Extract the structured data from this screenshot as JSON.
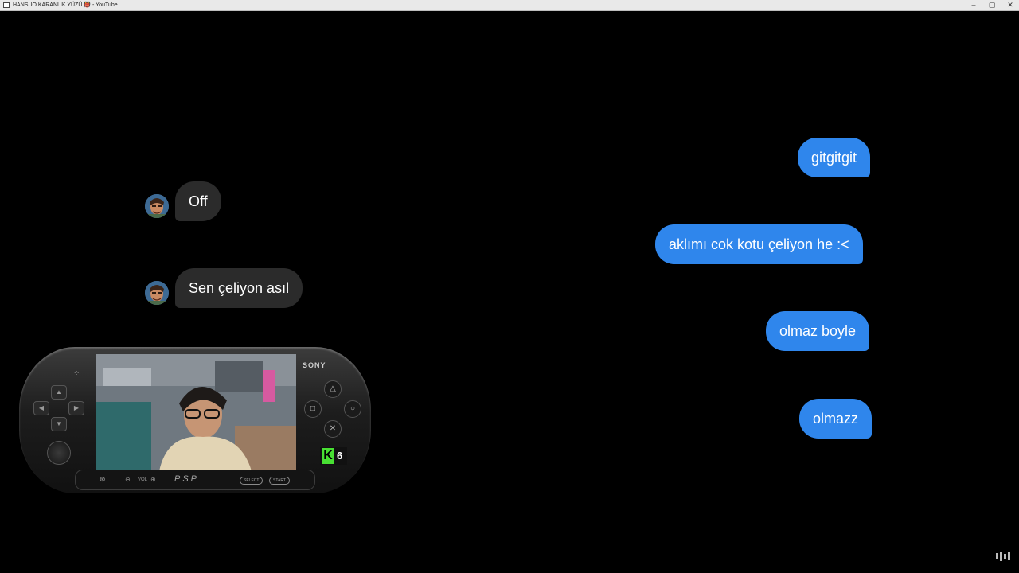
{
  "window": {
    "title": "HANSUO KARANLIK YÜZÜ 👹 - YouTube",
    "controls": {
      "minimize": "–",
      "maximize": "▢",
      "close": "✕"
    }
  },
  "chat": {
    "outgoing": [
      {
        "text": "gitgitgit"
      },
      {
        "text": "aklımı cok kotu çeliyon he :<"
      },
      {
        "text": "olmaz boyle"
      },
      {
        "text": "olmazz"
      }
    ],
    "incoming": [
      {
        "text": "Off"
      },
      {
        "text": "Sen çeliyon asıl"
      }
    ],
    "colors": {
      "outgoing_bubble": "#2f86ec",
      "incoming_bubble": "#2b2b2b",
      "background": "#000000"
    }
  },
  "psp_overlay": {
    "brand": "SONY",
    "logo": "PSP",
    "vol_label": "VOL",
    "select_label": "SELECT",
    "start_label": "START",
    "badge": {
      "letter": "K",
      "number": "6",
      "color": "#48e033"
    },
    "icons": [
      "dpad-up-icon",
      "dpad-left-icon",
      "dpad-right-icon",
      "dpad-down-icon",
      "triangle-icon",
      "square-icon",
      "circle-icon",
      "cross-icon",
      "playstation-icon"
    ]
  }
}
